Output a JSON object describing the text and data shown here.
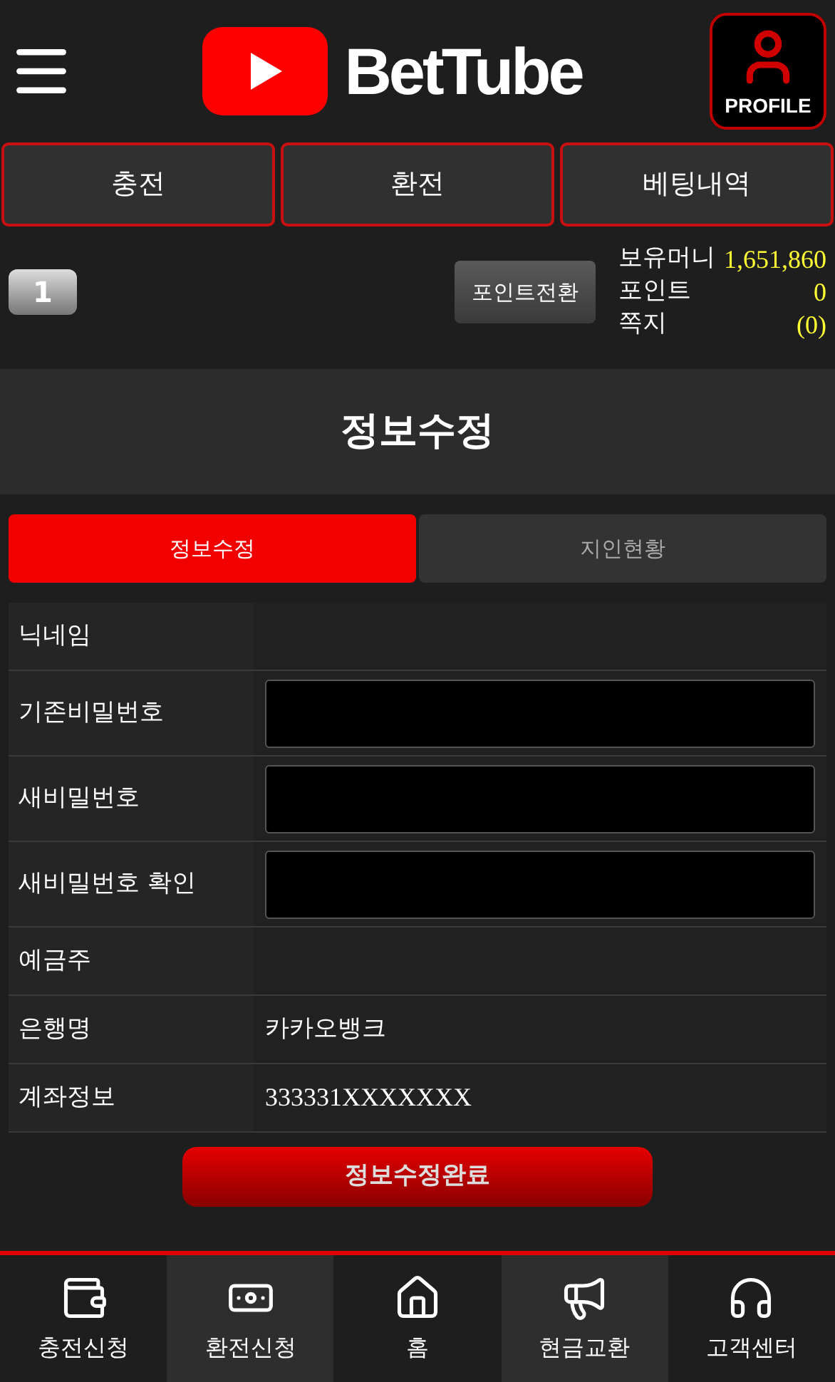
{
  "header": {
    "logo_text": "BetTube",
    "profile_label": "PROFILE"
  },
  "top_buttons": [
    "충전",
    "환전",
    "베팅내역"
  ],
  "user": {
    "level": "1",
    "convert_button": "포인트전환",
    "stats": [
      {
        "label": "보유머니",
        "value": "1,651,860"
      },
      {
        "label": "포인트",
        "value": "0"
      },
      {
        "label": "쪽지",
        "value": "(0)"
      }
    ]
  },
  "page_title": "정보수정",
  "tabs": [
    {
      "label": "정보수정",
      "selected": true
    },
    {
      "label": "지인현황",
      "selected": false
    }
  ],
  "form_rows": [
    {
      "kind": "text",
      "label": "닉네임"
    },
    {
      "kind": "input",
      "label": "기존비밀번호"
    },
    {
      "kind": "input",
      "label": "새비밀번호"
    },
    {
      "kind": "input",
      "label": "새비밀번호 확인"
    },
    {
      "kind": "text",
      "label": "예금주"
    },
    {
      "kind": "text",
      "label": "은행명",
      "value": "카카오뱅크"
    },
    {
      "kind": "text",
      "label": "계좌정보",
      "value": "333331XXXXXXX"
    }
  ],
  "submit_button": "정보수정완료",
  "bottom_nav": [
    {
      "label": "충전신청"
    },
    {
      "label": "환전신청"
    },
    {
      "label": "홈"
    },
    {
      "label": "현금교환"
    },
    {
      "label": "고객센터"
    }
  ]
}
